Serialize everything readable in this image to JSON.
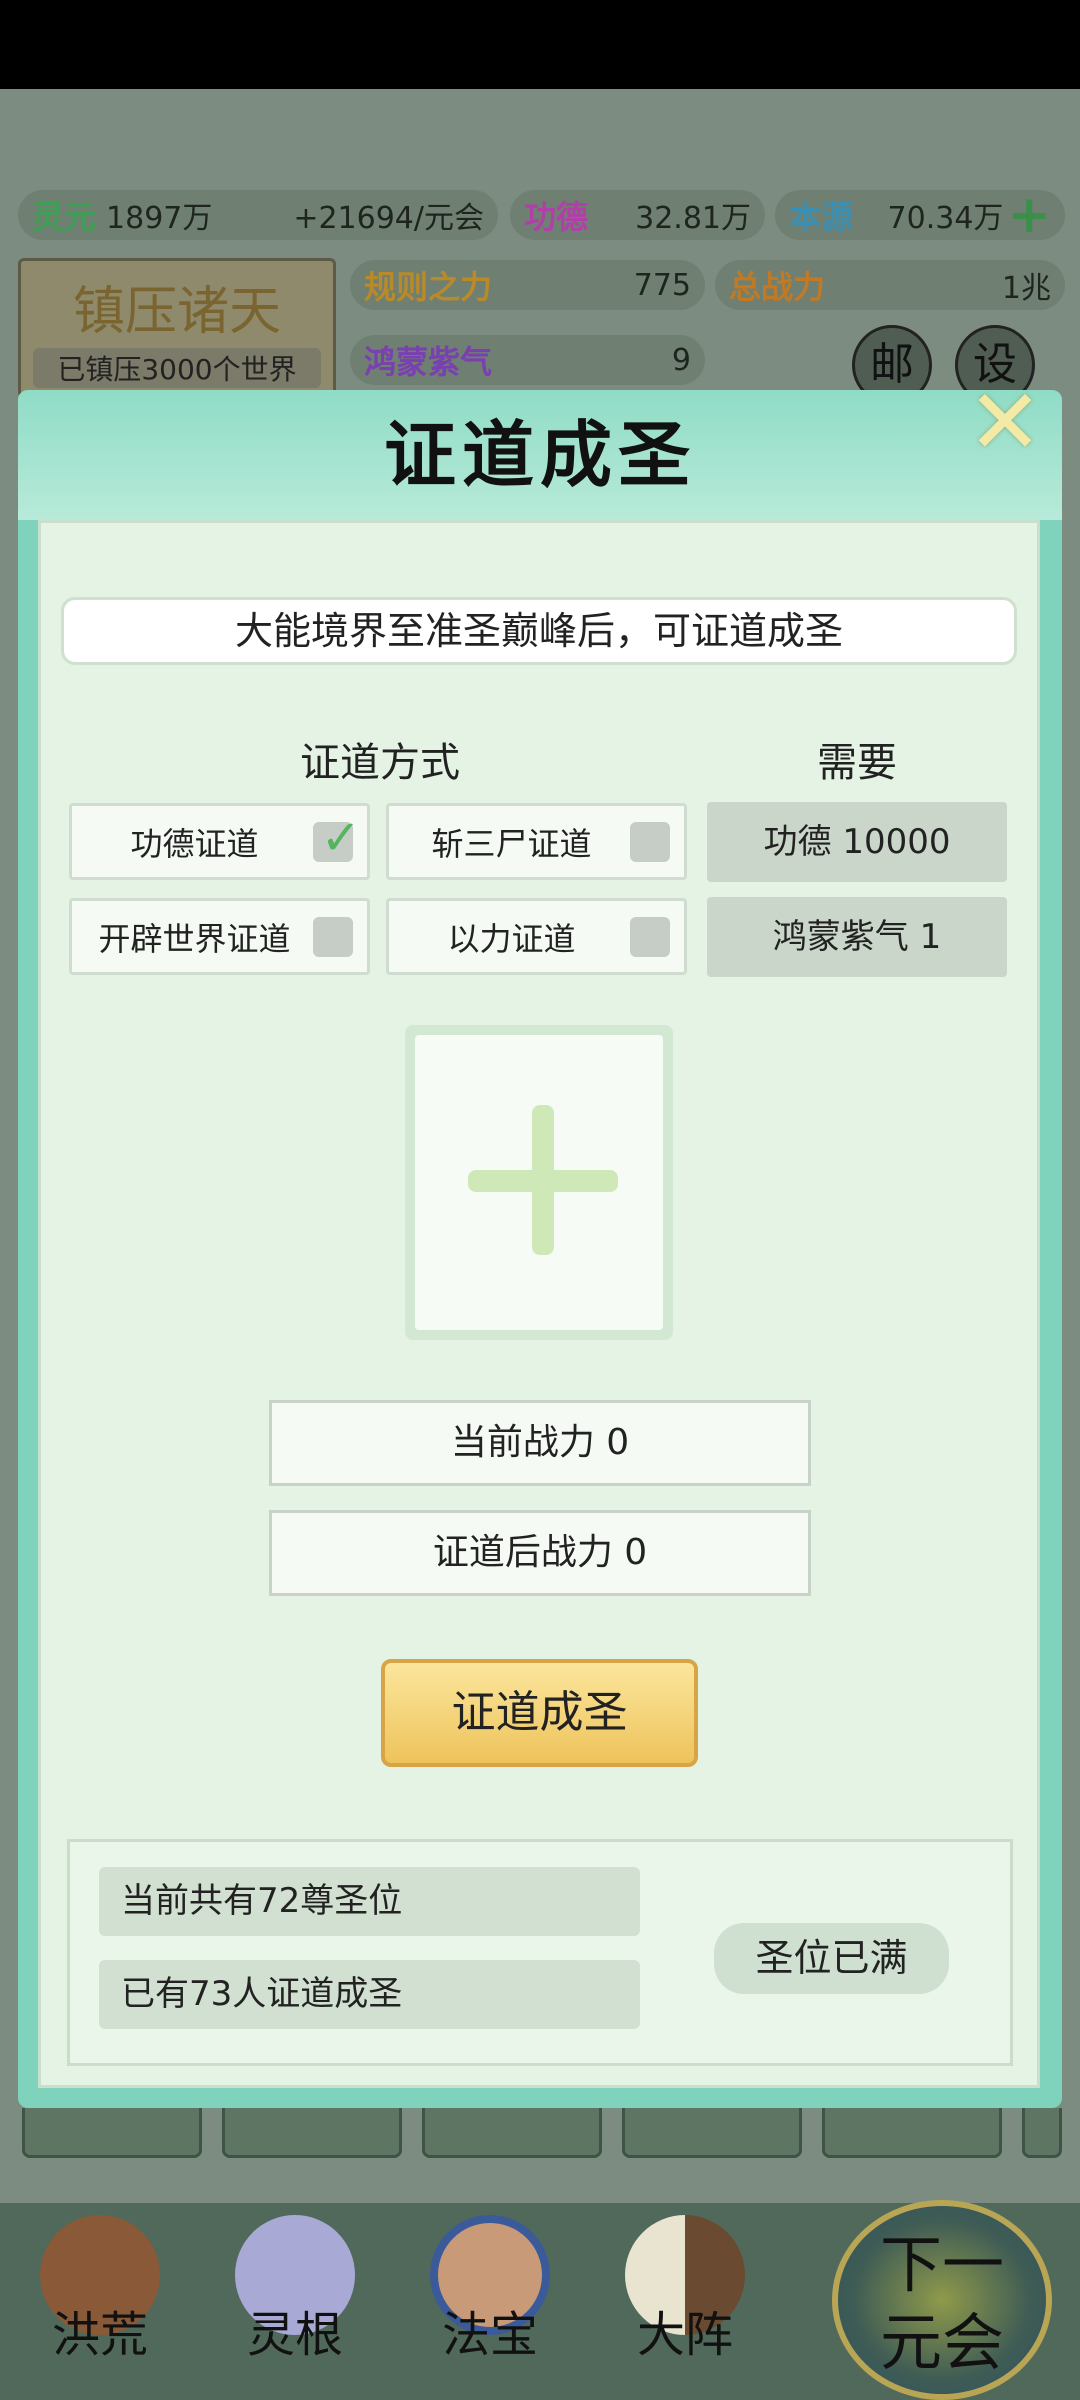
{
  "resources": {
    "lingyuan": {
      "label": "灵元",
      "value": "1897万",
      "rate": "+21694/元会"
    },
    "gongde": {
      "label": "功德",
      "value": "32.81万"
    },
    "benyuan": {
      "label": "本源",
      "value": "70.34万"
    },
    "guize": {
      "label": "规则之力",
      "value": "775"
    },
    "zongzhanli": {
      "label": "总战力",
      "value": "1兆"
    },
    "hongmeng": {
      "label": "鸿蒙紫气",
      "value": "9"
    }
  },
  "zhenya": {
    "title": "镇压诸天",
    "subtitle": "已镇压3000个世界"
  },
  "side_buttons": {
    "mail": "邮",
    "settings": "设"
  },
  "dialog": {
    "title": "证道成圣",
    "banner": "大能境界至准圣巅峰后，可证道成圣",
    "methods_header": "证道方式",
    "needs_header": "需要",
    "methods": [
      {
        "label": "功德证道",
        "checked": true
      },
      {
        "label": "斩三尸证道",
        "checked": false
      },
      {
        "label": "开辟世界证道",
        "checked": false
      },
      {
        "label": "以力证道",
        "checked": false
      }
    ],
    "needs": [
      "功德 10000",
      "鸿蒙紫气 1"
    ],
    "current_power": "当前战力  0",
    "after_power": "证道后战力  0",
    "confirm_button": "证道成圣",
    "info": [
      "当前共有72尊圣位",
      "已有73人证道成圣"
    ],
    "status": "圣位已满"
  },
  "nav": [
    {
      "label": "洪荒",
      "icon": "mountain-icon"
    },
    {
      "label": "灵根",
      "icon": "lotus-icon"
    },
    {
      "label": "法宝",
      "icon": "mirror-icon"
    },
    {
      "label": "大阵",
      "icon": "formation-icon"
    }
  ],
  "next_button": "下一元会"
}
